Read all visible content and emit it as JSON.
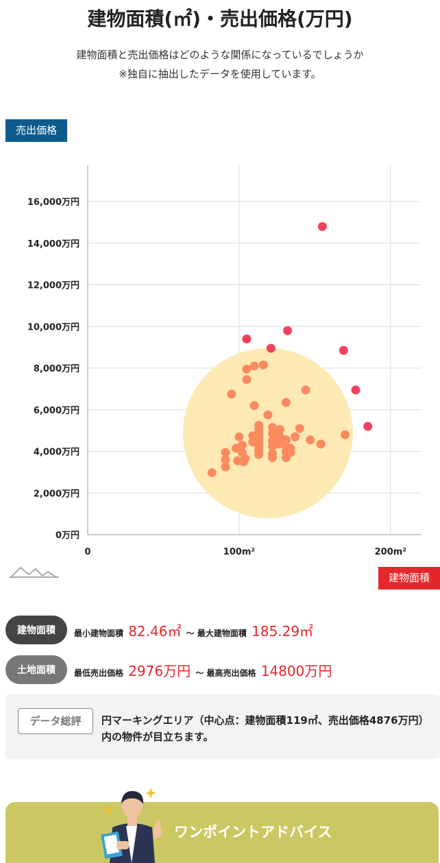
{
  "title": "建物面積(㎡)・売出価格(万円)",
  "subtitle_line1": "建物面積と売出価格はどのような関係になっているでしょうか",
  "subtitle_line2": "※独自に抽出したデータを使用しています。",
  "colors": {
    "accent_blue": "#0d5a8d",
    "accent_red": "#e5262b",
    "point_outlier": "#f0425c",
    "point_main": "#fb8a5f",
    "circle_fill": "#fde9b3",
    "advice_bg": "#cbc863"
  },
  "chart_data": {
    "type": "scatter",
    "xlabel": "建物面積",
    "ylabel": "売出価格",
    "xlim": [
      0,
      220
    ],
    "ylim": [
      0,
      18000
    ],
    "x_ticks": [
      {
        "value": 0,
        "label": "0"
      },
      {
        "value": 100,
        "label": "100m²"
      },
      {
        "value": 200,
        "label": "200m²"
      }
    ],
    "y_ticks": [
      {
        "value": 0,
        "label": "0万円"
      },
      {
        "value": 2000,
        "label": "2,000万円"
      },
      {
        "value": 4000,
        "label": "4,000万円"
      },
      {
        "value": 6000,
        "label": "6,000万円"
      },
      {
        "value": 8000,
        "label": "8,000万円"
      },
      {
        "value": 10000,
        "label": "10,000万円"
      },
      {
        "value": 12000,
        "label": "12,000万円"
      },
      {
        "value": 14000,
        "label": "14,000万円"
      },
      {
        "value": 16000,
        "label": "16,000万円"
      }
    ],
    "grid": true,
    "highlight_circle": {
      "x": 119,
      "y": 4876
    },
    "outliers": [
      {
        "x": 155,
        "y": 14800
      },
      {
        "x": 132,
        "y": 9800
      },
      {
        "x": 105,
        "y": 9400
      },
      {
        "x": 121,
        "y": 8950
      },
      {
        "x": 169,
        "y": 8850
      },
      {
        "x": 177,
        "y": 6950
      },
      {
        "x": 185,
        "y": 5200
      }
    ],
    "points": [
      {
        "x": 116,
        "y": 8150
      },
      {
        "x": 110,
        "y": 8100
      },
      {
        "x": 105,
        "y": 7950
      },
      {
        "x": 105,
        "y": 7450
      },
      {
        "x": 95,
        "y": 6750
      },
      {
        "x": 144,
        "y": 6950
      },
      {
        "x": 131,
        "y": 6350
      },
      {
        "x": 110,
        "y": 6200
      },
      {
        "x": 119,
        "y": 5750
      },
      {
        "x": 140,
        "y": 5100
      },
      {
        "x": 113,
        "y": 5250
      },
      {
        "x": 113,
        "y": 5050
      },
      {
        "x": 113,
        "y": 4850
      },
      {
        "x": 113,
        "y": 4650
      },
      {
        "x": 113,
        "y": 4450
      },
      {
        "x": 113,
        "y": 4250
      },
      {
        "x": 113,
        "y": 4050
      },
      {
        "x": 113,
        "y": 3850
      },
      {
        "x": 109,
        "y": 4750
      },
      {
        "x": 109,
        "y": 4450
      },
      {
        "x": 100,
        "y": 4700
      },
      {
        "x": 102,
        "y": 4300
      },
      {
        "x": 98,
        "y": 4150
      },
      {
        "x": 102,
        "y": 3950
      },
      {
        "x": 104,
        "y": 3650
      },
      {
        "x": 99,
        "y": 3550
      },
      {
        "x": 103,
        "y": 3500
      },
      {
        "x": 91,
        "y": 3950
      },
      {
        "x": 91,
        "y": 3600
      },
      {
        "x": 91,
        "y": 3250
      },
      {
        "x": 82,
        "y": 2976
      },
      {
        "x": 122,
        "y": 5150
      },
      {
        "x": 122,
        "y": 4850
      },
      {
        "x": 122,
        "y": 4500
      },
      {
        "x": 122,
        "y": 4250
      },
      {
        "x": 122,
        "y": 3900
      },
      {
        "x": 122,
        "y": 3700
      },
      {
        "x": 127,
        "y": 5050
      },
      {
        "x": 127,
        "y": 4700
      },
      {
        "x": 127,
        "y": 4400
      },
      {
        "x": 131,
        "y": 4550
      },
      {
        "x": 131,
        "y": 4250
      },
      {
        "x": 131,
        "y": 4000
      },
      {
        "x": 131,
        "y": 3700
      },
      {
        "x": 134,
        "y": 4150
      },
      {
        "x": 134,
        "y": 3950
      },
      {
        "x": 137,
        "y": 4700
      },
      {
        "x": 147,
        "y": 4550
      },
      {
        "x": 154,
        "y": 4350
      },
      {
        "x": 170,
        "y": 4800
      },
      {
        "x": 124,
        "y": 4950
      },
      {
        "x": 126,
        "y": 4350
      }
    ]
  },
  "stats": {
    "building_label": "建物面積",
    "min_area_label": "最小建物面積",
    "min_area_value": "82.46㎡",
    "sep1": "～",
    "max_area_label": "最大建物面積",
    "max_area_value": "185.29㎡",
    "land_label": "土地面積",
    "min_price_label": "最低売出価格",
    "min_price_value": "2976万円",
    "sep2": "～",
    "max_price_label": "最高売出価格",
    "max_price_value": "14800万円"
  },
  "summary": {
    "tag": "データ総評",
    "text": "円マーキングエリア（中心点：建物面積119㎡、売出価格4876万円）内の物件が目立ちます。"
  },
  "advice": {
    "label": "ワンポイントアドバイス"
  }
}
